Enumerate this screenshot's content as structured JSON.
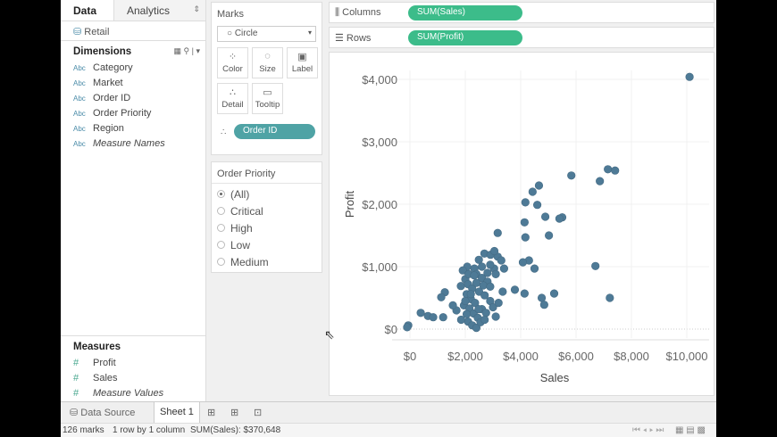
{
  "left": {
    "tabs": [
      "Data",
      "Analytics"
    ],
    "source": "Retail",
    "dimensions_title": "Dimensions",
    "dimensions": [
      {
        "icon": "Abc",
        "label": "Category"
      },
      {
        "icon": "Abc",
        "label": "Market"
      },
      {
        "icon": "Abc",
        "label": "Order ID"
      },
      {
        "icon": "Abc",
        "label": "Order Priority"
      },
      {
        "icon": "Abc",
        "label": "Region"
      },
      {
        "icon": "Abc",
        "label": "Measure Names"
      }
    ],
    "measures_title": "Measures",
    "measures": [
      {
        "icon": "#",
        "label": "Profit"
      },
      {
        "icon": "#",
        "label": "Sales"
      },
      {
        "icon": "#",
        "label": "Measure Values"
      }
    ]
  },
  "marks": {
    "title": "Marks",
    "type": "Circle",
    "buttons": [
      "Color",
      "Size",
      "Label",
      "Detail",
      "Tooltip"
    ],
    "pill": "Order ID"
  },
  "filter": {
    "title": "Order Priority",
    "options": [
      "(All)",
      "Critical",
      "High",
      "Low",
      "Medium"
    ],
    "selected": 0
  },
  "shelves": {
    "columns_label": "Columns",
    "columns_pill": "SUM(Sales)",
    "rows_label": "Rows",
    "rows_pill": "SUM(Profit)"
  },
  "bottom": {
    "data_source": "Data Source",
    "sheet": "Sheet 1"
  },
  "status": {
    "marks": "126 marks",
    "dims": "1 row by 1 column",
    "sum": "SUM(Sales): $370,648"
  },
  "colors": {
    "point": "#4e7a96",
    "pill_green": "#3cbc8a",
    "pill_teal": "#4fa3a5"
  },
  "chart_data": {
    "type": "scatter",
    "xlabel": "Sales",
    "ylabel": "Profit",
    "xlim": [
      -500,
      10500
    ],
    "ylim": [
      -300,
      4300
    ],
    "xticks": [
      {
        "v": 0,
        "label": "$0"
      },
      {
        "v": 2000,
        "label": "$2,000"
      },
      {
        "v": 4000,
        "label": "$4,000"
      },
      {
        "v": 6000,
        "label": "$6,000"
      },
      {
        "v": 8000,
        "label": "$8,000"
      },
      {
        "v": 10000,
        "label": "$10,000"
      }
    ],
    "yticks": [
      {
        "v": 0,
        "label": "$0"
      },
      {
        "v": 1000,
        "label": "$1,000"
      },
      {
        "v": 2000,
        "label": "$2,000"
      },
      {
        "v": 3000,
        "label": "$3,000"
      },
      {
        "v": 4000,
        "label": "$4,000"
      }
    ],
    "points": [
      [
        10100,
        4040
      ],
      [
        7150,
        2560
      ],
      [
        7410,
        2540
      ],
      [
        5830,
        2460
      ],
      [
        6860,
        2370
      ],
      [
        4660,
        2300
      ],
      [
        4430,
        2200
      ],
      [
        4170,
        2030
      ],
      [
        4600,
        1990
      ],
      [
        5500,
        1790
      ],
      [
        5400,
        1770
      ],
      [
        4890,
        1800
      ],
      [
        4140,
        1710
      ],
      [
        3170,
        1540
      ],
      [
        4170,
        1470
      ],
      [
        5020,
        1500
      ],
      [
        6700,
        1010
      ],
      [
        7220,
        500
      ],
      [
        4300,
        1100
      ],
      [
        4080,
        1070
      ],
      [
        4500,
        970
      ],
      [
        2690,
        1210
      ],
      [
        2910,
        1190
      ],
      [
        3170,
        1160
      ],
      [
        2490,
        1110
      ],
      [
        2070,
        1000
      ],
      [
        2330,
        970
      ],
      [
        1910,
        940
      ],
      [
        3040,
        970
      ],
      [
        3400,
        970
      ],
      [
        1260,
        590
      ],
      [
        1130,
        510
      ],
      [
        1840,
        690
      ],
      [
        3790,
        630
      ],
      [
        4140,
        570
      ],
      [
        4760,
        500
      ],
      [
        5210,
        570
      ],
      [
        4850,
        390
      ],
      [
        1680,
        300
      ],
      [
        650,
        210
      ],
      [
        -60,
        60
      ],
      [
        390,
        260
      ],
      [
        840,
        190
      ],
      [
        1200,
        190
      ],
      [
        -100,
        30
      ],
      [
        2000,
        800
      ],
      [
        2100,
        720
      ],
      [
        2250,
        650
      ],
      [
        2400,
        880
      ],
      [
        2600,
        820
      ],
      [
        2800,
        760
      ],
      [
        2050,
        560
      ],
      [
        2200,
        480
      ],
      [
        2350,
        420
      ],
      [
        2500,
        600
      ],
      [
        2700,
        540
      ],
      [
        2900,
        450
      ],
      [
        1950,
        380
      ],
      [
        2150,
        330
      ],
      [
        2300,
        250
      ],
      [
        2450,
        180
      ],
      [
        2600,
        320
      ],
      [
        2750,
        260
      ],
      [
        3000,
        350
      ],
      [
        3200,
        420
      ],
      [
        2100,
        120
      ],
      [
        2250,
        60
      ],
      [
        2400,
        20
      ],
      [
        2550,
        110
      ],
      [
        2050,
        240
      ],
      [
        2200,
        560
      ],
      [
        2650,
        700
      ],
      [
        2900,
        680
      ],
      [
        3100,
        880
      ],
      [
        2400,
        740
      ],
      [
        2800,
        900
      ],
      [
        3350,
        600
      ],
      [
        2000,
        450
      ],
      [
        2120,
        880
      ],
      [
        2480,
        320
      ],
      [
        1850,
        150
      ],
      [
        2700,
        150
      ],
      [
        3100,
        200
      ],
      [
        1550,
        380
      ],
      [
        2320,
        860
      ],
      [
        2600,
        1000
      ],
      [
        3300,
        1100
      ],
      [
        2900,
        1030
      ],
      [
        3050,
        1250
      ]
    ]
  }
}
